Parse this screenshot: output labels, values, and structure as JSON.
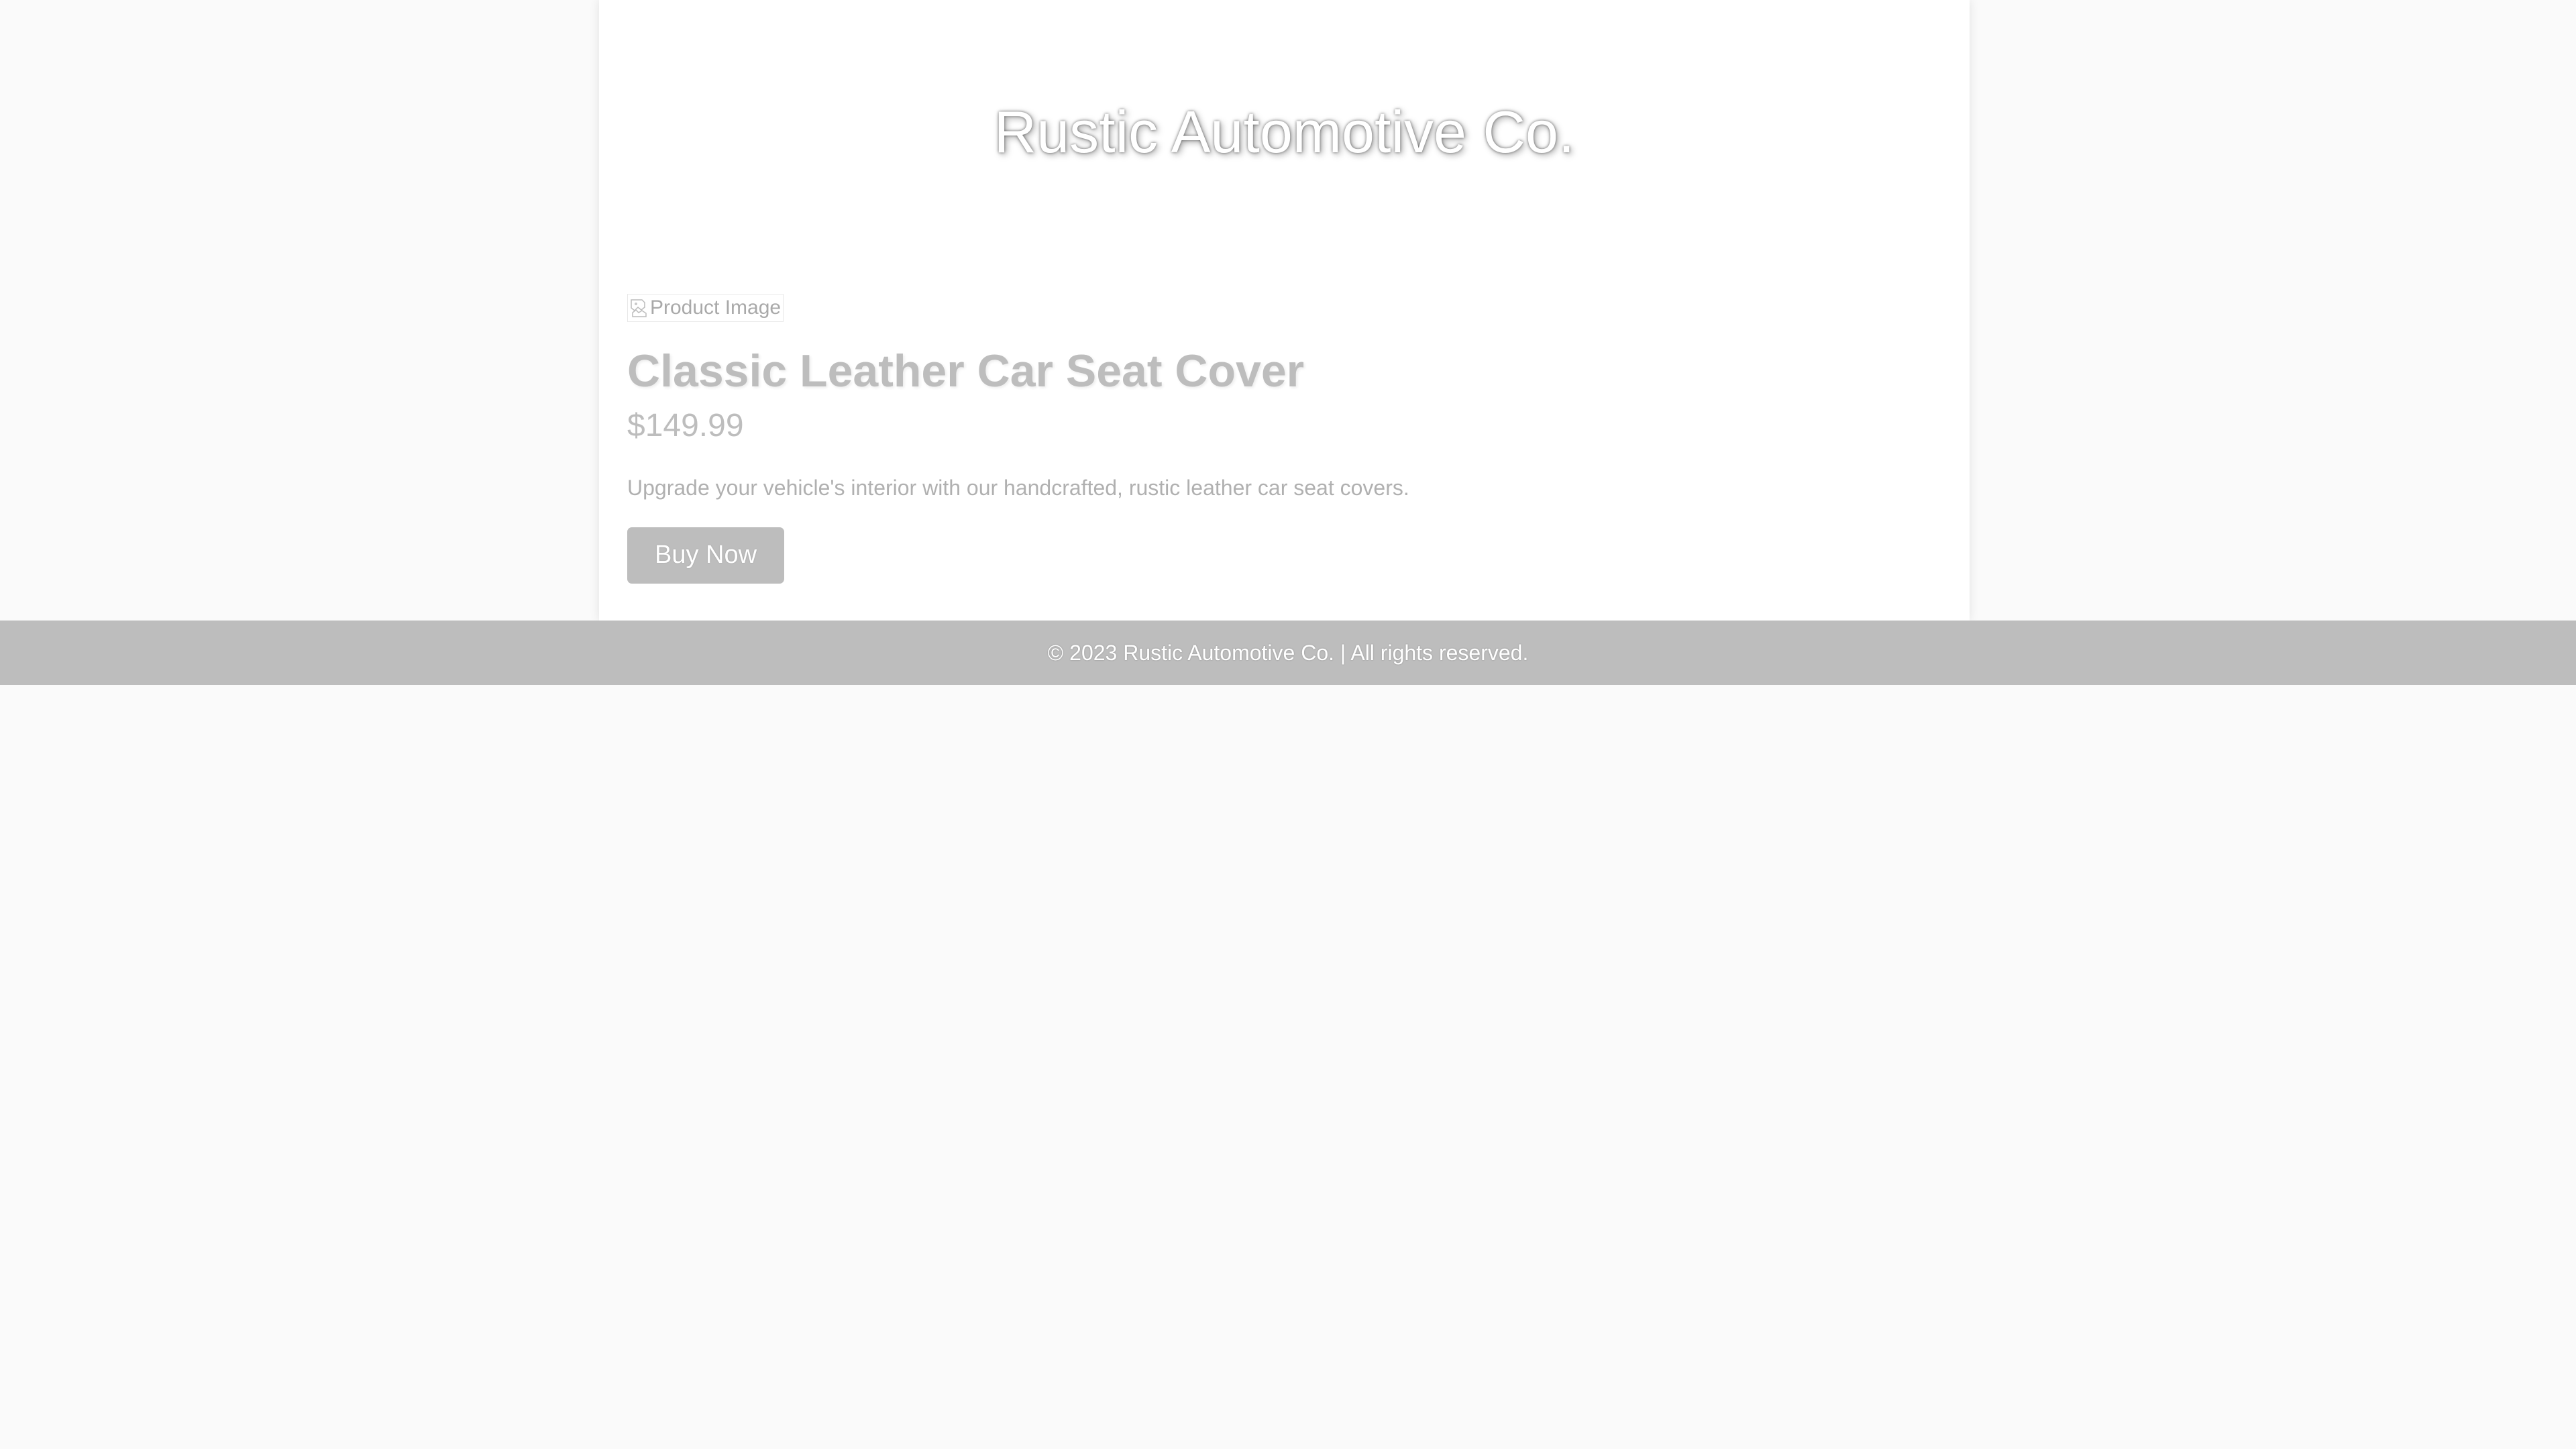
{
  "site": {
    "title": "Rustic Automotive Co."
  },
  "product": {
    "image_alt": "Product Image",
    "image_icon": "broken-image-icon",
    "name": "Classic Leather Car Seat Cover",
    "price": "$149.99",
    "description": "Upgrade your vehicle's interior with our handcrafted, rustic leather car seat covers.",
    "buy_label": "Buy Now"
  },
  "footer": {
    "copyright": "© 2023 Rustic Automotive Co. | All rights reserved."
  },
  "colors": {
    "page_background": "#fafafa",
    "container_background": "#ffffff",
    "accent_gray": "#bdbdbd",
    "muted_text": "#b0b0b0"
  }
}
